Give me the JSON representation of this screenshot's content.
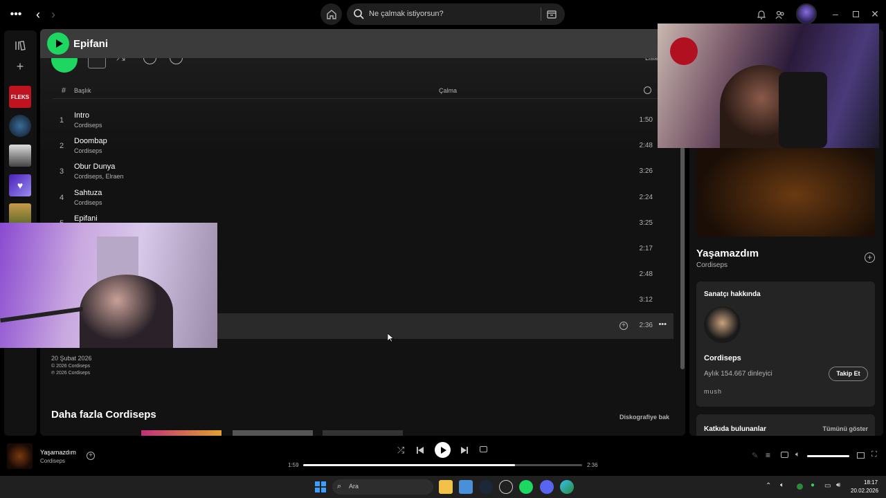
{
  "topbar": {
    "search_placeholder": "Ne çalmak istiyorsun?"
  },
  "album": {
    "title": "Epifani",
    "col_num": "#",
    "col_title": "Başlık",
    "col_plays": "Çalma",
    "list_label": "Liste",
    "tracks": [
      {
        "num": "1",
        "title": "Intro",
        "artist": "Cordiseps",
        "duration": "1:50"
      },
      {
        "num": "2",
        "title": "Doombap",
        "artist": "Cordiseps",
        "duration": "2:48"
      },
      {
        "num": "3",
        "title": "Obur Dunya",
        "artist": "Cordiseps, Elraen",
        "duration": "3:26"
      },
      {
        "num": "4",
        "title": "Sahtuza",
        "artist": "Cordiseps",
        "duration": "2:24"
      },
      {
        "num": "5",
        "title": "Epifani",
        "artist": "",
        "duration": "3:25"
      },
      {
        "num": "",
        "title": "",
        "artist": "",
        "duration": "2:17"
      },
      {
        "num": "",
        "title": "",
        "artist": "",
        "duration": "2:48"
      },
      {
        "num": "",
        "title": "",
        "artist": "",
        "duration": "3:12"
      },
      {
        "num": "",
        "title": "",
        "artist": "",
        "duration": "2:36"
      }
    ],
    "release_date": "20 Şubat 2026",
    "copyright1": "© 2026 Cordiseps",
    "copyright2": "℗ 2026 Cordiseps",
    "more_title": "Daha fazla Cordiseps",
    "discography_link": "Diskografiye bak"
  },
  "now_playing_panel": {
    "track": "Yaşamazdım",
    "artist": "Cordiseps",
    "about_title": "Sanatçı hakkında",
    "artist_name": "Cordiseps",
    "monthly": "Aylık 154.667 dinleyici",
    "follow_label": "Takip Et",
    "tag": "mush",
    "credits_title": "Katkıda bulunanlar",
    "show_all": "Tümünü göster"
  },
  "player": {
    "track": "Yaşamazdım",
    "artist": "Cordiseps",
    "elapsed": "1:59",
    "total": "2:36",
    "progress": 0.76,
    "volume": 1.0
  },
  "taskbar": {
    "search_label": "Ara",
    "time": "18:17",
    "date": "20.02.2026"
  },
  "colors": {
    "accent": "#1ed760",
    "bg": "#121212",
    "header": "#3b3b3b"
  }
}
